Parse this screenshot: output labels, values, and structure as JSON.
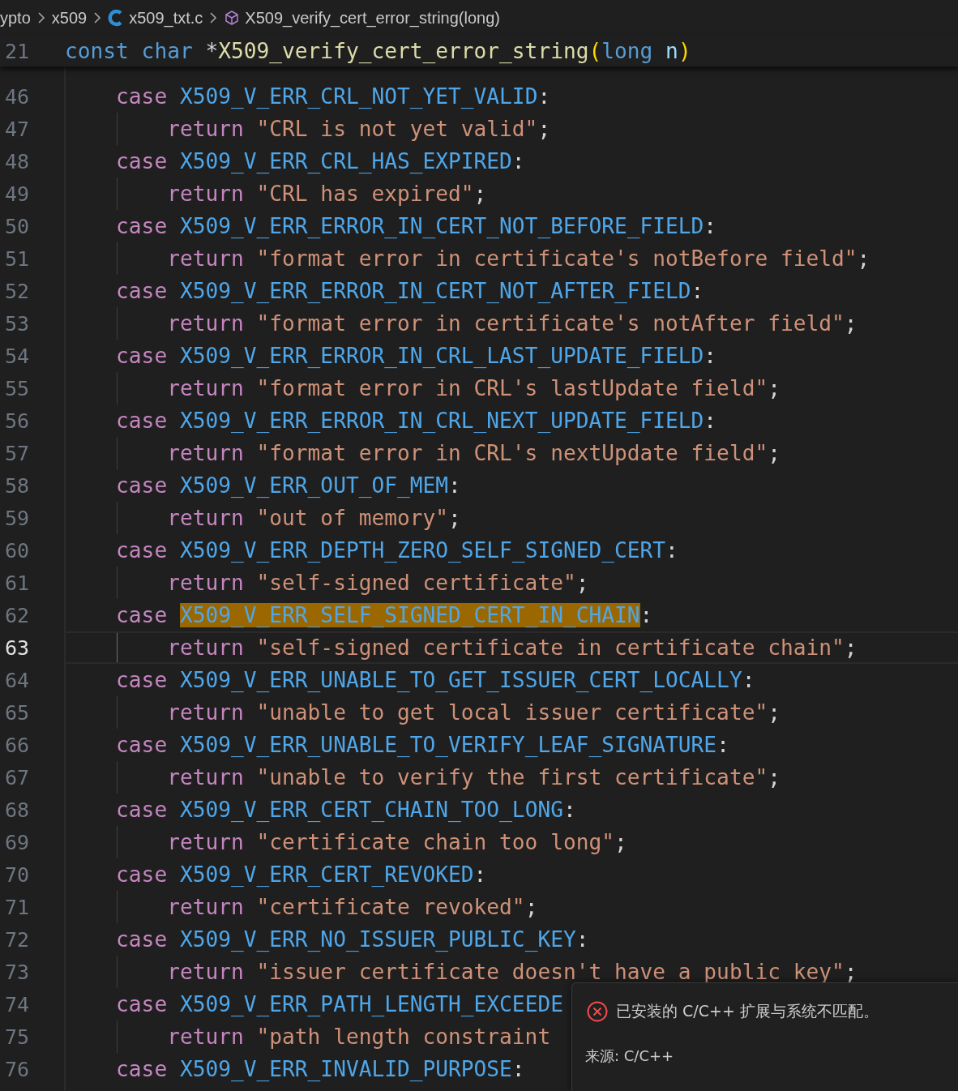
{
  "breadcrumb": [
    {
      "label": "ypto",
      "kind": "folder"
    },
    {
      "label": "x509",
      "kind": "folder"
    },
    {
      "label": "x509_txt.c",
      "kind": "file"
    },
    {
      "label": "X509_verify_cert_error_string(long)",
      "kind": "symbol"
    }
  ],
  "sticky_line": {
    "number": "21",
    "tokens": [
      {
        "text": "const",
        "kind": "type"
      },
      {
        "text": " char",
        "kind": "type"
      },
      {
        "text": " *",
        "kind": "plain"
      },
      {
        "text": "X509_verify_cert_error_string",
        "kind": "function"
      },
      {
        "text": "(",
        "kind": "bracket"
      },
      {
        "text": "long",
        "kind": "type"
      },
      {
        "text": " n",
        "kind": "param"
      },
      {
        "text": ")",
        "kind": "bracket"
      }
    ]
  },
  "lines": [
    {
      "number": "46",
      "kind": "case",
      "keyword": "case",
      "text": "X509_V_ERR_CRL_NOT_YET_VALID",
      "end": ":",
      "highlighted": false,
      "current": false
    },
    {
      "number": "47",
      "kind": "return",
      "keyword": "return",
      "text": "\"CRL is not yet valid\"",
      "end": ";",
      "highlighted": false,
      "current": false
    },
    {
      "number": "48",
      "kind": "case",
      "keyword": "case",
      "text": "X509_V_ERR_CRL_HAS_EXPIRED",
      "end": ":",
      "highlighted": false,
      "current": false
    },
    {
      "number": "49",
      "kind": "return",
      "keyword": "return",
      "text": "\"CRL has expired\"",
      "end": ";",
      "highlighted": false,
      "current": false
    },
    {
      "number": "50",
      "kind": "case",
      "keyword": "case",
      "text": "X509_V_ERR_ERROR_IN_CERT_NOT_BEFORE_FIELD",
      "end": ":",
      "highlighted": false,
      "current": false
    },
    {
      "number": "51",
      "kind": "return",
      "keyword": "return",
      "text": "\"format error in certificate's notBefore field\"",
      "end": ";",
      "highlighted": false,
      "current": false
    },
    {
      "number": "52",
      "kind": "case",
      "keyword": "case",
      "text": "X509_V_ERR_ERROR_IN_CERT_NOT_AFTER_FIELD",
      "end": ":",
      "highlighted": false,
      "current": false
    },
    {
      "number": "53",
      "kind": "return",
      "keyword": "return",
      "text": "\"format error in certificate's notAfter field\"",
      "end": ";",
      "highlighted": false,
      "current": false
    },
    {
      "number": "54",
      "kind": "case",
      "keyword": "case",
      "text": "X509_V_ERR_ERROR_IN_CRL_LAST_UPDATE_FIELD",
      "end": ":",
      "highlighted": false,
      "current": false
    },
    {
      "number": "55",
      "kind": "return",
      "keyword": "return",
      "text": "\"format error in CRL's lastUpdate field\"",
      "end": ";",
      "highlighted": false,
      "current": false
    },
    {
      "number": "56",
      "kind": "case",
      "keyword": "case",
      "text": "X509_V_ERR_ERROR_IN_CRL_NEXT_UPDATE_FIELD",
      "end": ":",
      "highlighted": false,
      "current": false
    },
    {
      "number": "57",
      "kind": "return",
      "keyword": "return",
      "text": "\"format error in CRL's nextUpdate field\"",
      "end": ";",
      "highlighted": false,
      "current": false
    },
    {
      "number": "58",
      "kind": "case",
      "keyword": "case",
      "text": "X509_V_ERR_OUT_OF_MEM",
      "end": ":",
      "highlighted": false,
      "current": false
    },
    {
      "number": "59",
      "kind": "return",
      "keyword": "return",
      "text": "\"out of memory\"",
      "end": ";",
      "highlighted": false,
      "current": false
    },
    {
      "number": "60",
      "kind": "case",
      "keyword": "case",
      "text": "X509_V_ERR_DEPTH_ZERO_SELF_SIGNED_CERT",
      "end": ":",
      "highlighted": false,
      "current": false
    },
    {
      "number": "61",
      "kind": "return",
      "keyword": "return",
      "text": "\"self-signed certificate\"",
      "end": ";",
      "highlighted": false,
      "current": false
    },
    {
      "number": "62",
      "kind": "case",
      "keyword": "case",
      "text": "X509_V_ERR_SELF_SIGNED_CERT_IN_CHAIN",
      "end": ":",
      "highlighted": true,
      "current": false
    },
    {
      "number": "63",
      "kind": "return",
      "keyword": "return",
      "text": "\"self-signed certificate in certificate chain\"",
      "end": ";",
      "highlighted": false,
      "current": true
    },
    {
      "number": "64",
      "kind": "case",
      "keyword": "case",
      "text": "X509_V_ERR_UNABLE_TO_GET_ISSUER_CERT_LOCALLY",
      "end": ":",
      "highlighted": false,
      "current": false
    },
    {
      "number": "65",
      "kind": "return",
      "keyword": "return",
      "text": "\"unable to get local issuer certificate\"",
      "end": ";",
      "highlighted": false,
      "current": false
    },
    {
      "number": "66",
      "kind": "case",
      "keyword": "case",
      "text": "X509_V_ERR_UNABLE_TO_VERIFY_LEAF_SIGNATURE",
      "end": ":",
      "highlighted": false,
      "current": false
    },
    {
      "number": "67",
      "kind": "return",
      "keyword": "return",
      "text": "\"unable to verify the first certificate\"",
      "end": ";",
      "highlighted": false,
      "current": false
    },
    {
      "number": "68",
      "kind": "case",
      "keyword": "case",
      "text": "X509_V_ERR_CERT_CHAIN_TOO_LONG",
      "end": ":",
      "highlighted": false,
      "current": false
    },
    {
      "number": "69",
      "kind": "return",
      "keyword": "return",
      "text": "\"certificate chain too long\"",
      "end": ";",
      "highlighted": false,
      "current": false
    },
    {
      "number": "70",
      "kind": "case",
      "keyword": "case",
      "text": "X509_V_ERR_CERT_REVOKED",
      "end": ":",
      "highlighted": false,
      "current": false
    },
    {
      "number": "71",
      "kind": "return",
      "keyword": "return",
      "text": "\"certificate revoked\"",
      "end": ";",
      "highlighted": false,
      "current": false
    },
    {
      "number": "72",
      "kind": "case",
      "keyword": "case",
      "text": "X509_V_ERR_NO_ISSUER_PUBLIC_KEY",
      "end": ":",
      "highlighted": false,
      "current": false
    },
    {
      "number": "73",
      "kind": "return",
      "keyword": "return",
      "text": "\"issuer certificate doesn't have a public key\"",
      "end": ";",
      "highlighted": false,
      "current": false
    },
    {
      "number": "74",
      "kind": "case",
      "keyword": "case",
      "text": "X509_V_ERR_PATH_LENGTH_EXCEEDE",
      "highlighted": false,
      "current": false
    },
    {
      "number": "75",
      "kind": "return",
      "keyword": "return",
      "text": "\"path length constraint",
      "highlighted": false,
      "current": false
    },
    {
      "number": "76",
      "kind": "case",
      "keyword": "case",
      "text": "X509_V_ERR_INVALID_PURPOSE",
      "end": ":",
      "highlighted": false,
      "current": false
    }
  ],
  "notification": {
    "message": "已安装的 C/C++ 扩展与系统不匹配。",
    "source": "来源: C/C++"
  }
}
